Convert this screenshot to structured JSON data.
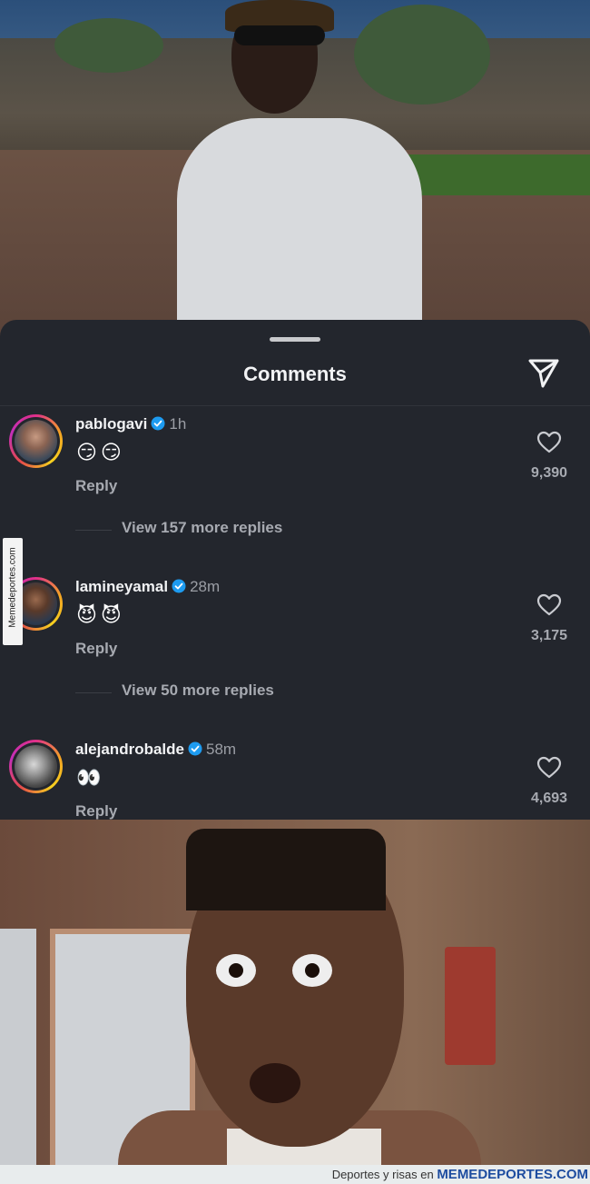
{
  "sheet": {
    "title": "Comments"
  },
  "comments": [
    {
      "username": "pablogavi",
      "time": "1h",
      "emojis": "😏😏",
      "reply_label": "Reply",
      "likes": "9,390",
      "view_more": "View 157 more replies"
    },
    {
      "username": "lamineyamal",
      "time": "28m",
      "emojis": "😈😈",
      "reply_label": "Reply",
      "likes": "3,175",
      "view_more": "View 50 more replies"
    },
    {
      "username": "alejandrobalde",
      "time": "58m",
      "emojis": "👀",
      "reply_label": "Reply",
      "likes": "4,693"
    }
  ],
  "watermark": {
    "side_text": "Memedeportes.com",
    "footer_prefix": "Deportes y risas en",
    "footer_brand": "MEMEDEPORTES.COM"
  },
  "colors": {
    "sheet_bg": "#23262d",
    "verified": "#1d9bf0",
    "text_primary": "#f1f2f4",
    "text_secondary": "#a7aab1"
  },
  "icons": {
    "share": "paper-plane-icon",
    "like": "heart-outline-icon",
    "verified": "verified-badge-icon"
  }
}
